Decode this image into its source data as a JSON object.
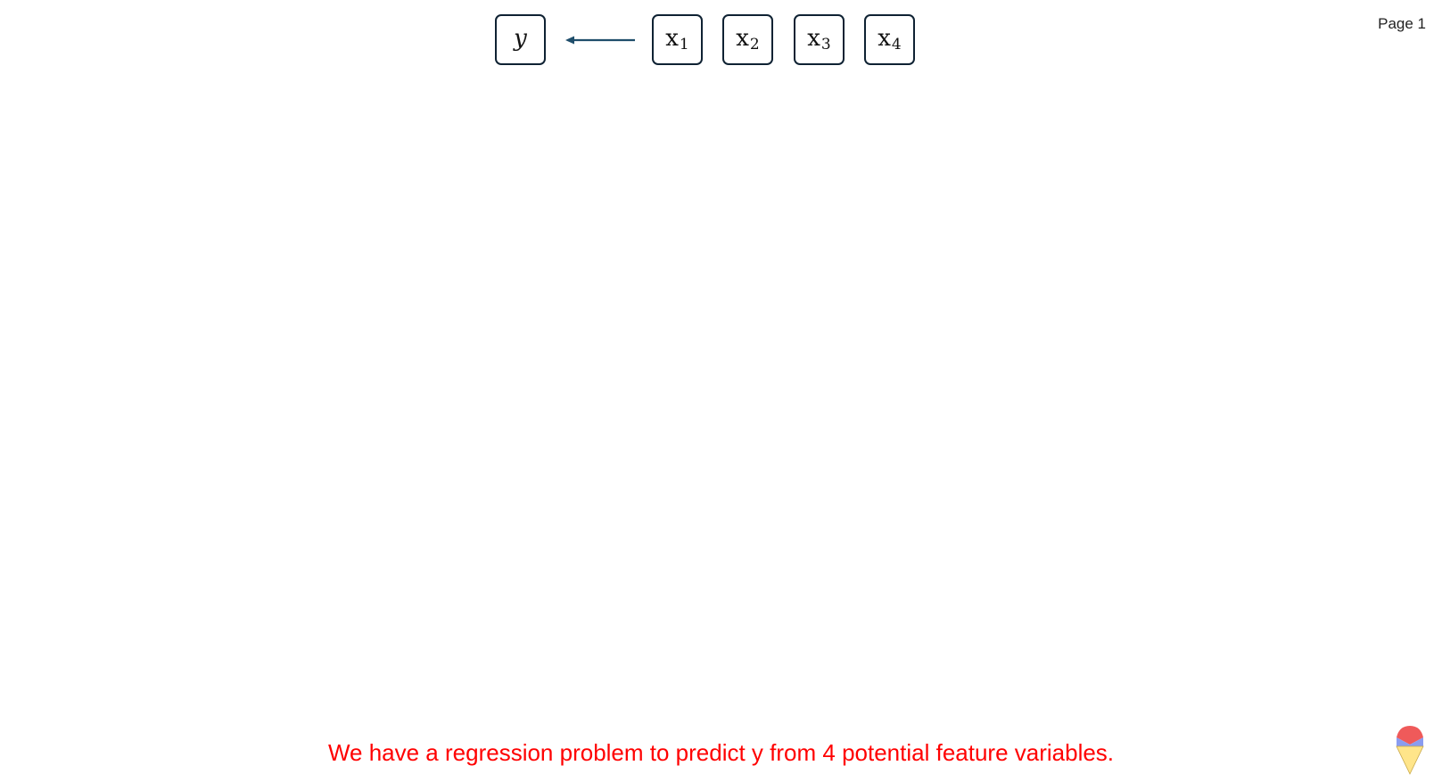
{
  "page_label": "Page 1",
  "diagram": {
    "target": {
      "symbol": "y"
    },
    "features": [
      {
        "symbol": "x",
        "subscript": "1"
      },
      {
        "symbol": "x",
        "subscript": "2"
      },
      {
        "symbol": "x",
        "subscript": "3"
      },
      {
        "symbol": "x",
        "subscript": "4"
      }
    ],
    "arrow_color": "#1f4e6b"
  },
  "caption": {
    "text": "We have a regression problem to predict y from 4 potential feature variables.",
    "color": "#ff0000"
  },
  "logo": {
    "icon": "cone-logo-icon",
    "colors": [
      "#ef5a5a",
      "#8a9cf0",
      "#ffe58a"
    ]
  }
}
